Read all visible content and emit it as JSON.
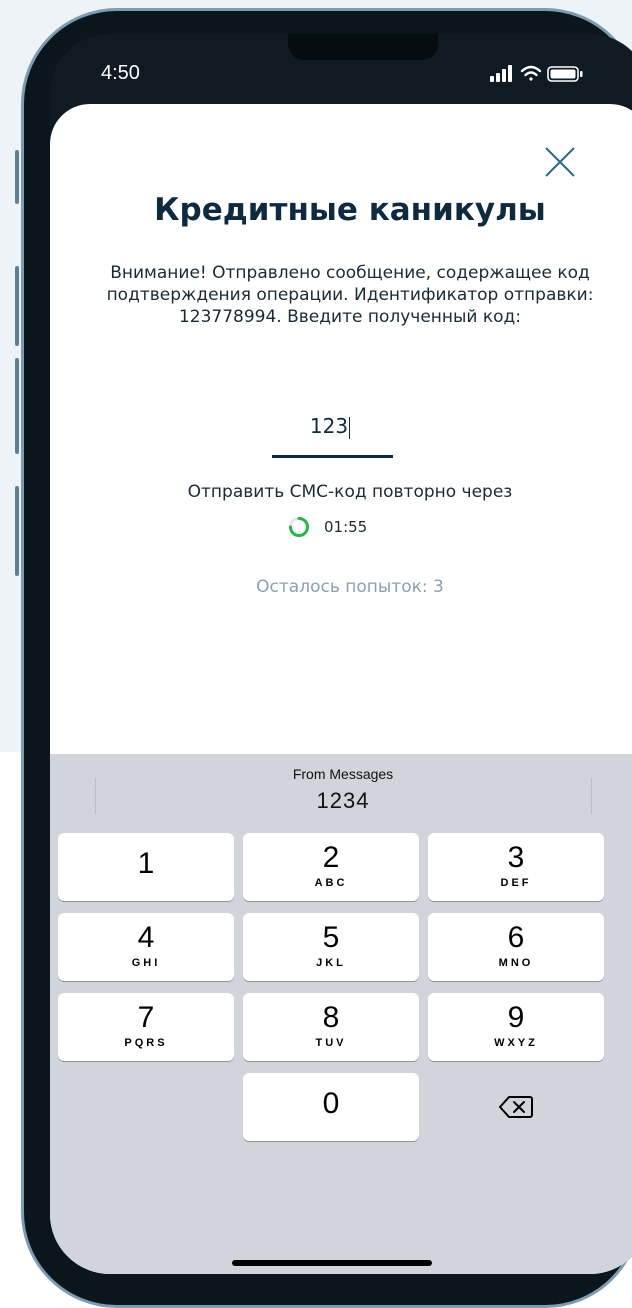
{
  "status_bar": {
    "time": "4:50"
  },
  "modal": {
    "title": "Кредитные каникулы",
    "description": "Внимание! Отправлено сообщение, содержащее код подтверждения операции. Идентификатор отправки: 123778994. Введите полученный код:",
    "code_value": "123",
    "resend_label": "Отправить СМС-код повторно через",
    "timer": "01:55",
    "attempts": "Осталось попыток: 3",
    "close_icon": "close-icon",
    "spinner_color": "#2bb34b"
  },
  "keyboard": {
    "suggestion_label": "From Messages",
    "suggestion_code": "1234",
    "keys": [
      {
        "digit": "1",
        "letters": ""
      },
      {
        "digit": "2",
        "letters": "ABC"
      },
      {
        "digit": "3",
        "letters": "DEF"
      },
      {
        "digit": "4",
        "letters": "GHI"
      },
      {
        "digit": "5",
        "letters": "JKL"
      },
      {
        "digit": "6",
        "letters": "MNO"
      },
      {
        "digit": "7",
        "letters": "PQRS"
      },
      {
        "digit": "8",
        "letters": "TUV"
      },
      {
        "digit": "9",
        "letters": "WXYZ"
      },
      {
        "digit": "0",
        "letters": ""
      }
    ],
    "delete_icon": "backspace-icon"
  },
  "colors": {
    "title": "#0e2a3f",
    "muted": "#8aa0b0",
    "keyboard_bg": "#d1d4da"
  }
}
